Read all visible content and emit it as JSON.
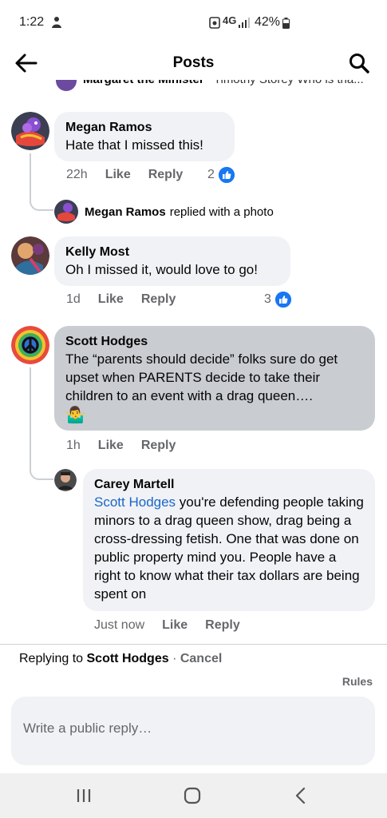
{
  "status_bar": {
    "time": "1:22",
    "network": "4G",
    "battery": "42%"
  },
  "header": {
    "title": "Posts"
  },
  "partial_row": {
    "author": "Margaret the Minister",
    "text": "Timothy Storey Who is tha..."
  },
  "comments": [
    {
      "author": "Megan Ramos",
      "text": "Hate that I missed this!",
      "time": "22h",
      "like_label": "Like",
      "reply_label": "Reply",
      "reactions": "2"
    },
    {
      "author": "Kelly Most",
      "text": "Oh I missed it, would love to go!",
      "time": "1d",
      "like_label": "Like",
      "reply_label": "Reply",
      "reactions": "3"
    },
    {
      "author": "Scott Hodges",
      "text": "The “parents should decide” folks sure do get upset when PARENTS decide to take their children to an event with a drag queen….",
      "emoji": "🤷‍♂️",
      "time": "1h",
      "like_label": "Like",
      "reply_label": "Reply"
    }
  ],
  "reply_summary": {
    "author": "Megan Ramos",
    "text": "replied with a photo"
  },
  "nested_reply": {
    "author": "Carey Martell",
    "mention": "Scott Hodges",
    "text": " you're defending people taking minors to a drag queen show, drag being a cross-dressing fetish. One that was done on public property mind you. People have a right to know what their tax dollars are being spent on",
    "time": "Just now",
    "like_label": "Like",
    "reply_label": "Reply"
  },
  "replying_bar": {
    "prefix": "Replying to ",
    "name": "Scott Hodges",
    "separator": " · ",
    "cancel": "Cancel",
    "rules": "Rules"
  },
  "composer": {
    "placeholder": "Write a public reply…"
  },
  "colors": {
    "accent": "#1877f2",
    "mention": "#1b66c9",
    "bubble": "#f0f2f5",
    "highlighted_bubble": "#c9ccd1"
  }
}
